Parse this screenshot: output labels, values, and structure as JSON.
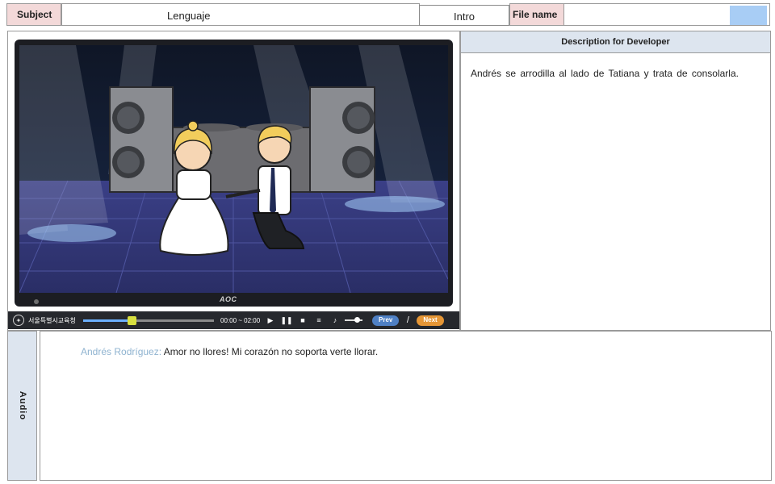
{
  "header": {
    "subject_label": "Subject",
    "subject_value": "Lenguaje",
    "section_value": "Intro",
    "filename_label": "File name",
    "swatch_color": "#a8cdf5"
  },
  "player": {
    "brand": "AOC",
    "name": "서울특별시교육청",
    "time": "00:00 ~ 02:00",
    "progress": 0.37,
    "prev_label": "Prev",
    "separator": "/",
    "next_label": "Next"
  },
  "description": {
    "title": "Description for Developer",
    "text": "Andrés se arrodilla al lado de Tatiana y trata de consolarla."
  },
  "audio": {
    "label": "Audio",
    "speaker": "Andrés Rodríguez:",
    "text": " Amor no llores! Mi corazón no soporta verte llorar."
  },
  "icons": {
    "play": "play-icon",
    "pause": "pause-icon",
    "stop": "stop-icon",
    "menu": "menu-icon",
    "volume": "volume-icon"
  }
}
